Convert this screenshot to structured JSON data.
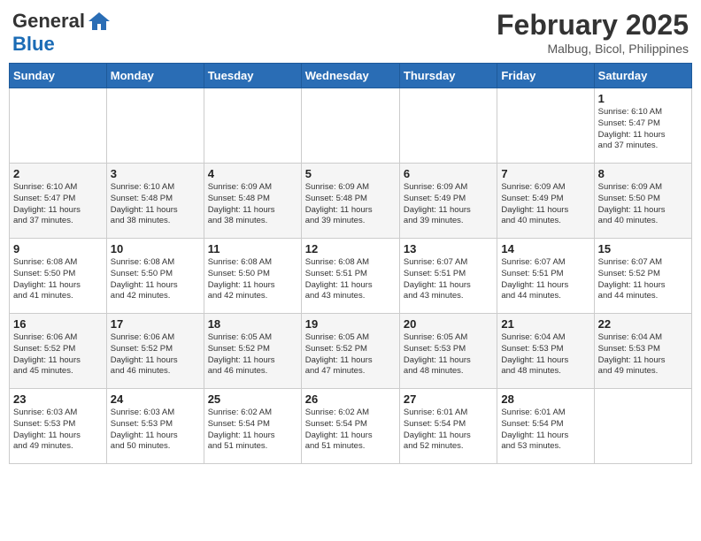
{
  "header": {
    "logo_line1": "General",
    "logo_line2": "Blue",
    "month_year": "February 2025",
    "location": "Malbug, Bicol, Philippines"
  },
  "days_of_week": [
    "Sunday",
    "Monday",
    "Tuesday",
    "Wednesday",
    "Thursday",
    "Friday",
    "Saturday"
  ],
  "weeks": [
    [
      {
        "day": "",
        "info": ""
      },
      {
        "day": "",
        "info": ""
      },
      {
        "day": "",
        "info": ""
      },
      {
        "day": "",
        "info": ""
      },
      {
        "day": "",
        "info": ""
      },
      {
        "day": "",
        "info": ""
      },
      {
        "day": "1",
        "info": "Sunrise: 6:10 AM\nSunset: 5:47 PM\nDaylight: 11 hours\nand 37 minutes."
      }
    ],
    [
      {
        "day": "2",
        "info": "Sunrise: 6:10 AM\nSunset: 5:47 PM\nDaylight: 11 hours\nand 37 minutes."
      },
      {
        "day": "3",
        "info": "Sunrise: 6:10 AM\nSunset: 5:48 PM\nDaylight: 11 hours\nand 38 minutes."
      },
      {
        "day": "4",
        "info": "Sunrise: 6:09 AM\nSunset: 5:48 PM\nDaylight: 11 hours\nand 38 minutes."
      },
      {
        "day": "5",
        "info": "Sunrise: 6:09 AM\nSunset: 5:48 PM\nDaylight: 11 hours\nand 39 minutes."
      },
      {
        "day": "6",
        "info": "Sunrise: 6:09 AM\nSunset: 5:49 PM\nDaylight: 11 hours\nand 39 minutes."
      },
      {
        "day": "7",
        "info": "Sunrise: 6:09 AM\nSunset: 5:49 PM\nDaylight: 11 hours\nand 40 minutes."
      },
      {
        "day": "8",
        "info": "Sunrise: 6:09 AM\nSunset: 5:50 PM\nDaylight: 11 hours\nand 40 minutes."
      }
    ],
    [
      {
        "day": "9",
        "info": "Sunrise: 6:08 AM\nSunset: 5:50 PM\nDaylight: 11 hours\nand 41 minutes."
      },
      {
        "day": "10",
        "info": "Sunrise: 6:08 AM\nSunset: 5:50 PM\nDaylight: 11 hours\nand 42 minutes."
      },
      {
        "day": "11",
        "info": "Sunrise: 6:08 AM\nSunset: 5:50 PM\nDaylight: 11 hours\nand 42 minutes."
      },
      {
        "day": "12",
        "info": "Sunrise: 6:08 AM\nSunset: 5:51 PM\nDaylight: 11 hours\nand 43 minutes."
      },
      {
        "day": "13",
        "info": "Sunrise: 6:07 AM\nSunset: 5:51 PM\nDaylight: 11 hours\nand 43 minutes."
      },
      {
        "day": "14",
        "info": "Sunrise: 6:07 AM\nSunset: 5:51 PM\nDaylight: 11 hours\nand 44 minutes."
      },
      {
        "day": "15",
        "info": "Sunrise: 6:07 AM\nSunset: 5:52 PM\nDaylight: 11 hours\nand 44 minutes."
      }
    ],
    [
      {
        "day": "16",
        "info": "Sunrise: 6:06 AM\nSunset: 5:52 PM\nDaylight: 11 hours\nand 45 minutes."
      },
      {
        "day": "17",
        "info": "Sunrise: 6:06 AM\nSunset: 5:52 PM\nDaylight: 11 hours\nand 46 minutes."
      },
      {
        "day": "18",
        "info": "Sunrise: 6:05 AM\nSunset: 5:52 PM\nDaylight: 11 hours\nand 46 minutes."
      },
      {
        "day": "19",
        "info": "Sunrise: 6:05 AM\nSunset: 5:52 PM\nDaylight: 11 hours\nand 47 minutes."
      },
      {
        "day": "20",
        "info": "Sunrise: 6:05 AM\nSunset: 5:53 PM\nDaylight: 11 hours\nand 48 minutes."
      },
      {
        "day": "21",
        "info": "Sunrise: 6:04 AM\nSunset: 5:53 PM\nDaylight: 11 hours\nand 48 minutes."
      },
      {
        "day": "22",
        "info": "Sunrise: 6:04 AM\nSunset: 5:53 PM\nDaylight: 11 hours\nand 49 minutes."
      }
    ],
    [
      {
        "day": "23",
        "info": "Sunrise: 6:03 AM\nSunset: 5:53 PM\nDaylight: 11 hours\nand 49 minutes."
      },
      {
        "day": "24",
        "info": "Sunrise: 6:03 AM\nSunset: 5:53 PM\nDaylight: 11 hours\nand 50 minutes."
      },
      {
        "day": "25",
        "info": "Sunrise: 6:02 AM\nSunset: 5:54 PM\nDaylight: 11 hours\nand 51 minutes."
      },
      {
        "day": "26",
        "info": "Sunrise: 6:02 AM\nSunset: 5:54 PM\nDaylight: 11 hours\nand 51 minutes."
      },
      {
        "day": "27",
        "info": "Sunrise: 6:01 AM\nSunset: 5:54 PM\nDaylight: 11 hours\nand 52 minutes."
      },
      {
        "day": "28",
        "info": "Sunrise: 6:01 AM\nSunset: 5:54 PM\nDaylight: 11 hours\nand 53 minutes."
      },
      {
        "day": "",
        "info": ""
      }
    ]
  ]
}
